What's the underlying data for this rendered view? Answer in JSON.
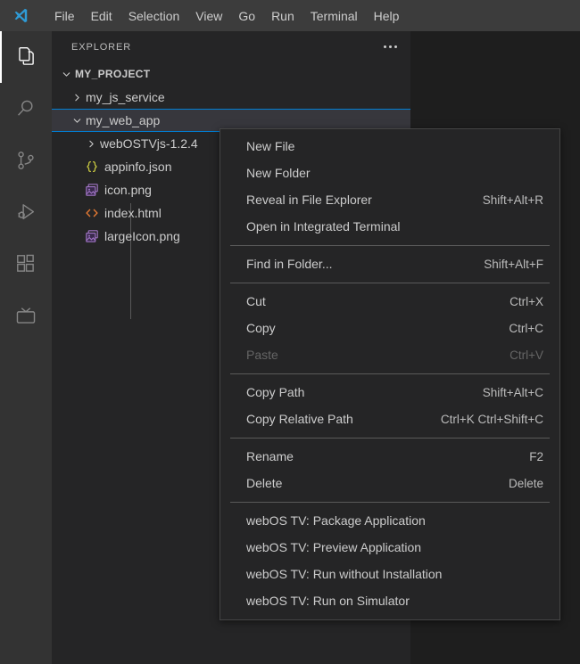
{
  "window": {
    "logo_icon": "vscode-logo-icon",
    "menubar": [
      {
        "label": "File"
      },
      {
        "label": "Edit"
      },
      {
        "label": "Selection"
      },
      {
        "label": "View"
      },
      {
        "label": "Go"
      },
      {
        "label": "Run"
      },
      {
        "label": "Terminal"
      },
      {
        "label": "Help"
      }
    ]
  },
  "colors": {
    "titlebar_bg": "#3c3c3c",
    "activitybar_bg": "#333333",
    "sidebar_bg": "#252526",
    "editor_bg": "#1e1e1e",
    "menu_bg": "#252526",
    "menu_border": "#454545",
    "selection_bg": "#37373d",
    "focus_border": "#007fd4",
    "text": "#cccccc",
    "text_dim": "#656565",
    "json_icon": "#cbcb41",
    "image_icon": "#a074c4",
    "html_icon": "#e37933",
    "active_indicator": "#ffffff"
  },
  "activitybar": {
    "items": [
      {
        "icon": "files-explorer-icon",
        "name": "explorer",
        "active": true
      },
      {
        "icon": "search-icon",
        "name": "search",
        "active": false
      },
      {
        "icon": "source-control-icon",
        "name": "source-control",
        "active": false
      },
      {
        "icon": "run-and-debug-icon",
        "name": "run-and-debug",
        "active": false
      },
      {
        "icon": "extensions-icon",
        "name": "extensions",
        "active": false
      },
      {
        "icon": "tv-icon",
        "name": "webos-tv",
        "active": false
      }
    ]
  },
  "sidebar": {
    "title": "EXPLORER",
    "more_actions_icon": "ellipsis-icon",
    "tree": [
      {
        "label": "MY_PROJECT",
        "type": "root-folder",
        "expanded": true,
        "twisty": "chevron-down-icon",
        "selected": false
      },
      {
        "label": "my_js_service",
        "type": "folder",
        "expanded": false,
        "twisty": "chevron-right-icon",
        "selected": false
      },
      {
        "label": "my_web_app",
        "type": "folder",
        "expanded": true,
        "twisty": "chevron-down-icon",
        "selected": true
      },
      {
        "label": "webOSTVjs-1.2.4",
        "type": "folder",
        "expanded": false,
        "twisty": "chevron-right-icon",
        "selected": false
      },
      {
        "label": "appinfo.json",
        "type": "file",
        "icon": "json-file-icon",
        "selected": false
      },
      {
        "label": "icon.png",
        "type": "file",
        "icon": "image-file-icon",
        "selected": false
      },
      {
        "label": "index.html",
        "type": "file",
        "icon": "html-file-icon",
        "selected": false
      },
      {
        "label": "largeIcon.png",
        "type": "file",
        "icon": "image-file-icon",
        "selected": false
      }
    ]
  },
  "context_menu": {
    "target": "my_web_app",
    "groups": [
      {
        "items": [
          {
            "label": "New File",
            "shortcut": "",
            "disabled": false
          },
          {
            "label": "New Folder",
            "shortcut": "",
            "disabled": false
          },
          {
            "label": "Reveal in File Explorer",
            "shortcut": "Shift+Alt+R",
            "disabled": false
          },
          {
            "label": "Open in Integrated Terminal",
            "shortcut": "",
            "disabled": false
          }
        ]
      },
      {
        "items": [
          {
            "label": "Find in Folder...",
            "shortcut": "Shift+Alt+F",
            "disabled": false
          }
        ]
      },
      {
        "items": [
          {
            "label": "Cut",
            "shortcut": "Ctrl+X",
            "disabled": false
          },
          {
            "label": "Copy",
            "shortcut": "Ctrl+C",
            "disabled": false
          },
          {
            "label": "Paste",
            "shortcut": "Ctrl+V",
            "disabled": true
          }
        ]
      },
      {
        "items": [
          {
            "label": "Copy Path",
            "shortcut": "Shift+Alt+C",
            "disabled": false
          },
          {
            "label": "Copy Relative Path",
            "shortcut": "Ctrl+K Ctrl+Shift+C",
            "disabled": false
          }
        ]
      },
      {
        "items": [
          {
            "label": "Rename",
            "shortcut": "F2",
            "disabled": false
          },
          {
            "label": "Delete",
            "shortcut": "Delete",
            "disabled": false
          }
        ]
      },
      {
        "items": [
          {
            "label": "webOS TV: Package Application",
            "shortcut": "",
            "disabled": false
          },
          {
            "label": "webOS TV: Preview Application",
            "shortcut": "",
            "disabled": false
          },
          {
            "label": "webOS TV: Run without Installation",
            "shortcut": "",
            "disabled": false
          },
          {
            "label": "webOS TV: Run on Simulator",
            "shortcut": "",
            "disabled": false
          }
        ]
      }
    ]
  }
}
